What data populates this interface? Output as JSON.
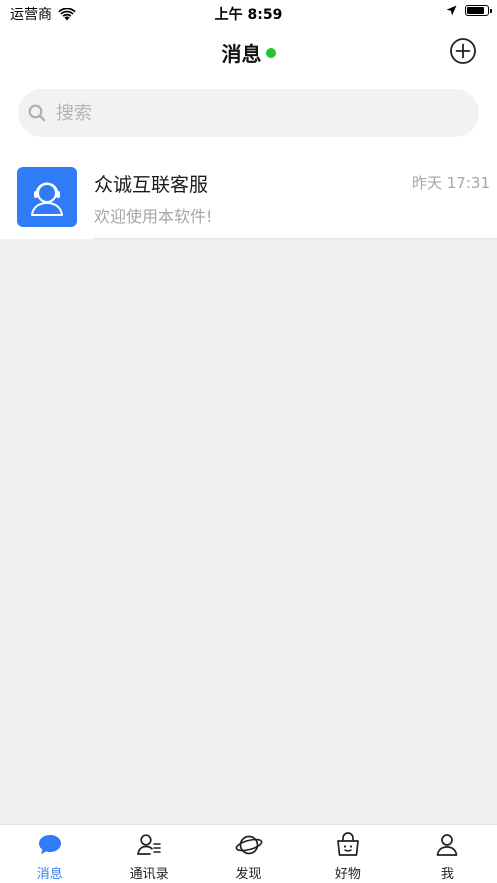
{
  "status_bar": {
    "carrier": "运营商",
    "time": "上午 8:59",
    "battery_level": 0.9
  },
  "header": {
    "title": "消息",
    "online_status_color": "#22c531",
    "add_icon": "plus-circle-icon"
  },
  "search": {
    "placeholder": "搜索",
    "value": ""
  },
  "conversations": [
    {
      "name": "众诚互联客服",
      "time": "昨天 17:31",
      "preview": "欢迎使用本软件!",
      "avatar_icon": "customer-service-icon",
      "avatar_color": "#2f7cf6"
    }
  ],
  "tab_bar": {
    "active_color": "#2f7cf6",
    "items": [
      {
        "label": "消息",
        "icon": "chat-bubble-icon",
        "active": true
      },
      {
        "label": "通讯录",
        "icon": "contacts-icon",
        "active": false
      },
      {
        "label": "发现",
        "icon": "planet-icon",
        "active": false
      },
      {
        "label": "好物",
        "icon": "shopping-basket-icon",
        "active": false
      },
      {
        "label": "我",
        "icon": "person-icon",
        "active": false
      }
    ]
  }
}
